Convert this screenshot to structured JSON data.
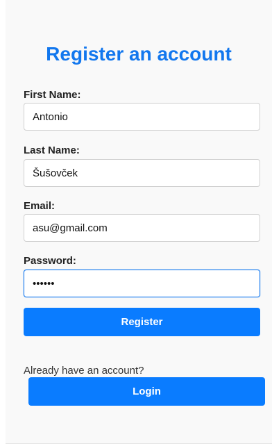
{
  "form": {
    "title": "Register an account",
    "fields": [
      {
        "label": "First Name:",
        "value": "Antonio",
        "type": "text"
      },
      {
        "label": "Last Name:",
        "value": "Šušovček",
        "type": "text"
      },
      {
        "label": "Email:",
        "value": "asu@gmail.com",
        "type": "text"
      },
      {
        "label": "Password:",
        "value": "••••••",
        "type": "password"
      }
    ],
    "register_label": "Register",
    "login_prompt": "Already have an account?",
    "login_label": "Login"
  },
  "colors": {
    "accent": "#0a7cff",
    "title": "#1277ee",
    "background": "#f9f9f9"
  }
}
